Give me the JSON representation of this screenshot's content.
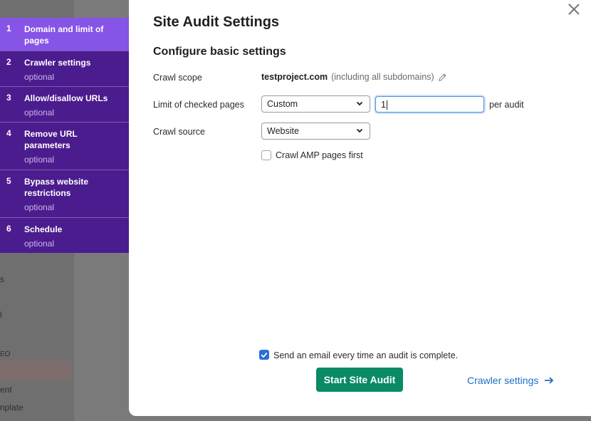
{
  "background": {
    "sidebar_fragments": [
      "s",
      "l",
      "EO",
      "ent",
      "nplate"
    ]
  },
  "steps": [
    {
      "num": "1",
      "title": "Domain and limit of pages",
      "sub": ""
    },
    {
      "num": "2",
      "title": "Crawler settings",
      "sub": "optional"
    },
    {
      "num": "3",
      "title": "Allow/disallow URLs",
      "sub": "optional"
    },
    {
      "num": "4",
      "title": "Remove URL parameters",
      "sub": "optional"
    },
    {
      "num": "5",
      "title": "Bypass website restrictions",
      "sub": "optional"
    },
    {
      "num": "6",
      "title": "Schedule",
      "sub": "optional"
    }
  ],
  "modal": {
    "title": "Site Audit Settings",
    "section_title": "Configure basic settings",
    "crawl_scope_label": "Crawl scope",
    "crawl_scope_domain": "testproject.com",
    "crawl_scope_note": "(including all subdomains)",
    "limit_label": "Limit of checked pages",
    "limit_select": "Custom",
    "limit_value": "1",
    "per_audit": "per audit",
    "source_label": "Crawl source",
    "source_select": "Website",
    "amp_label": "Crawl AMP pages first",
    "email_label": "Send an email every time an audit is complete.",
    "start_button": "Start Site Audit",
    "crawler_link": "Crawler settings"
  },
  "colors": {
    "step_active": "#8654e6",
    "step_default": "#4b1c8d",
    "primary_button": "#0b8a67",
    "link": "#1f6fc4",
    "checkbox_checked": "#2a6fd6"
  }
}
